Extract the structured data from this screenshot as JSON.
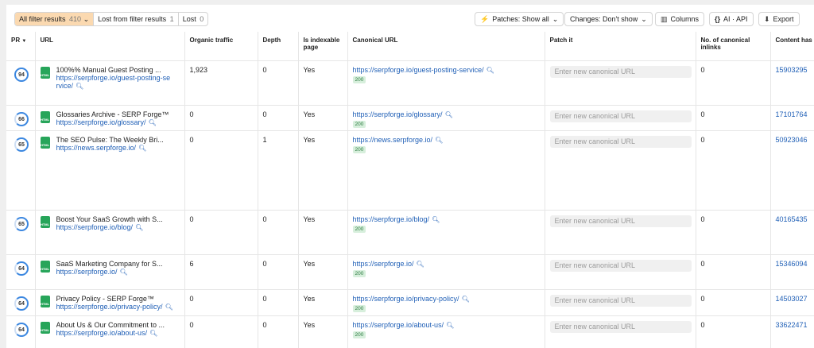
{
  "toolbar": {
    "seg1": {
      "label": "All filter results",
      "count": "410",
      "chevron": "⌄"
    },
    "seg2": {
      "label": "Lost from filter results",
      "count": "1"
    },
    "seg3": {
      "label": "Lost",
      "count": "0"
    },
    "patches": "Patches: Show all",
    "changes": "Changes: Don't show",
    "columns": "Columns",
    "ai_api": "AI · API",
    "export": "Export"
  },
  "columns": {
    "pr": "PR",
    "url": "URL",
    "organic": "Organic traffic",
    "depth": "Depth",
    "indexable": "Is indexable page",
    "canonical": "Canonical URL",
    "patch": "Patch it",
    "inlinks": "No. of canonical inlinks",
    "content": "Content has"
  },
  "patch_placeholder": "Enter new canonical URL",
  "rows": [
    {
      "pr": "94",
      "title": "100%% Manual Guest Posting ...",
      "url": "https://serpforge.io/guest-posting-se rvice/",
      "organic": "1,923",
      "depth": "0",
      "indexable": "Yes",
      "canonical": "https://serpforge.io/guest-posting-service/",
      "status": "200",
      "inlinks": "0",
      "content": "15903295"
    },
    {
      "pr": "66",
      "title": "Glossaries Archive - SERP Forge™",
      "url": "https://serpforge.io/glossary/",
      "organic": "0",
      "depth": "0",
      "indexable": "Yes",
      "canonical": "https://serpforge.io/glossary/",
      "status": "200",
      "inlinks": "0",
      "content": "17101764"
    },
    {
      "pr": "65",
      "title": "The SEO Pulse: The Weekly Bri...",
      "url": "https://news.serpforge.io/",
      "organic": "0",
      "depth": "1",
      "indexable": "Yes",
      "canonical": "https://news.serpforge.io/",
      "status": "200",
      "inlinks": "0",
      "content": "50923046"
    },
    {
      "pr": "65",
      "title": "Boost Your SaaS Growth with S...",
      "url": "https://serpforge.io/blog/",
      "organic": "0",
      "depth": "0",
      "indexable": "Yes",
      "canonical": "https://serpforge.io/blog/",
      "status": "200",
      "inlinks": "0",
      "content": "40165435"
    },
    {
      "pr": "64",
      "title": "SaaS Marketing Company for S...",
      "url": "https://serpforge.io/",
      "organic": "6",
      "depth": "0",
      "indexable": "Yes",
      "canonical": "https://serpforge.io/",
      "status": "200",
      "inlinks": "0",
      "content": "15346094"
    },
    {
      "pr": "64",
      "title": "Privacy Policy - SERP Forge™",
      "url": "https://serpforge.io/privacy-policy/",
      "organic": "0",
      "depth": "0",
      "indexable": "Yes",
      "canonical": "https://serpforge.io/privacy-policy/",
      "status": "200",
      "inlinks": "0",
      "content": "14503027"
    },
    {
      "pr": "64",
      "title": "About Us & Our Commitment to ...",
      "url": "https://serpforge.io/about-us/",
      "organic": "0",
      "depth": "0",
      "indexable": "Yes",
      "canonical": "https://serpforge.io/about-us/",
      "status": "200",
      "inlinks": "0",
      "content": "33622471"
    }
  ]
}
